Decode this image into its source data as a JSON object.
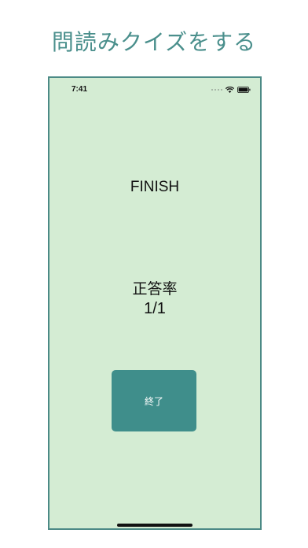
{
  "promo": {
    "title": "問読みクイズをする"
  },
  "status_bar": {
    "time": "7:41",
    "icons": [
      "signal-icon",
      "wifi-icon",
      "battery-icon"
    ]
  },
  "screen": {
    "title": "FINISH",
    "accuracy_label": "正答率",
    "accuracy_value": "1/1",
    "end_button_label": "終了"
  },
  "colors": {
    "banner_text": "#4a8f8c",
    "screen_background": "#d4ecd3",
    "button_background": "#3f8e8b",
    "frame_border": "#4c8a86"
  }
}
